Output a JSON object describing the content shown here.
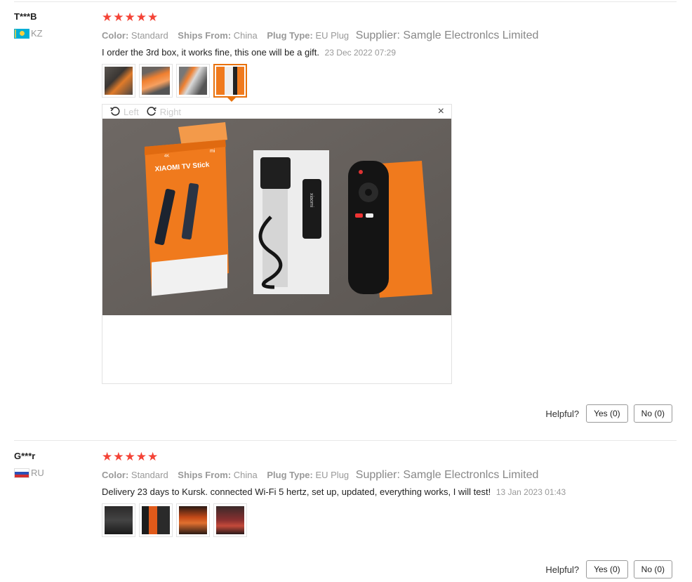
{
  "reviews": [
    {
      "user": "T***B",
      "country": "KZ",
      "stars": "★★★★★",
      "props": {
        "color_label": "Color:",
        "color_value": "Standard",
        "ships_label": "Ships From:",
        "ships_value": "China",
        "plug_label": "Plug Type:",
        "plug_value": "EU Plug",
        "supplier": "Supplier: Samgle Electronlcs Limited"
      },
      "text": "I order the 3rd box, it works fine, this one will be a gift.",
      "date": "23 Dec 2022 07:29",
      "viewer": {
        "left_label": "Left",
        "right_label": "Right",
        "close": "×"
      },
      "helpful": {
        "label": "Helpful?",
        "yes": "Yes (0)",
        "no": "No (0)"
      }
    },
    {
      "user": "G***r",
      "country": "RU",
      "stars": "★★★★★",
      "props": {
        "color_label": "Color:",
        "color_value": "Standard",
        "ships_label": "Ships From:",
        "ships_value": "China",
        "plug_label": "Plug Type:",
        "plug_value": "EU Plug",
        "supplier": "Supplier: Samgle Electronlcs Limited"
      },
      "text": "Delivery 23 days to Kursk. connected Wi-Fi 5 hertz, set up, updated, everything works, I will test!",
      "date": "13 Jan 2023 01:43",
      "helpful": {
        "label": "Helpful?",
        "yes": "Yes (0)",
        "no": "No (0)"
      }
    }
  ],
  "photo_text": {
    "badge": "4K",
    "brand": "XIAOMI TV Stick",
    "mi": "mi",
    "stick": "xiaomi"
  },
  "colors": {
    "star": "#f44336",
    "accent": "#e8710a",
    "box_orange": "#f07a1d"
  }
}
